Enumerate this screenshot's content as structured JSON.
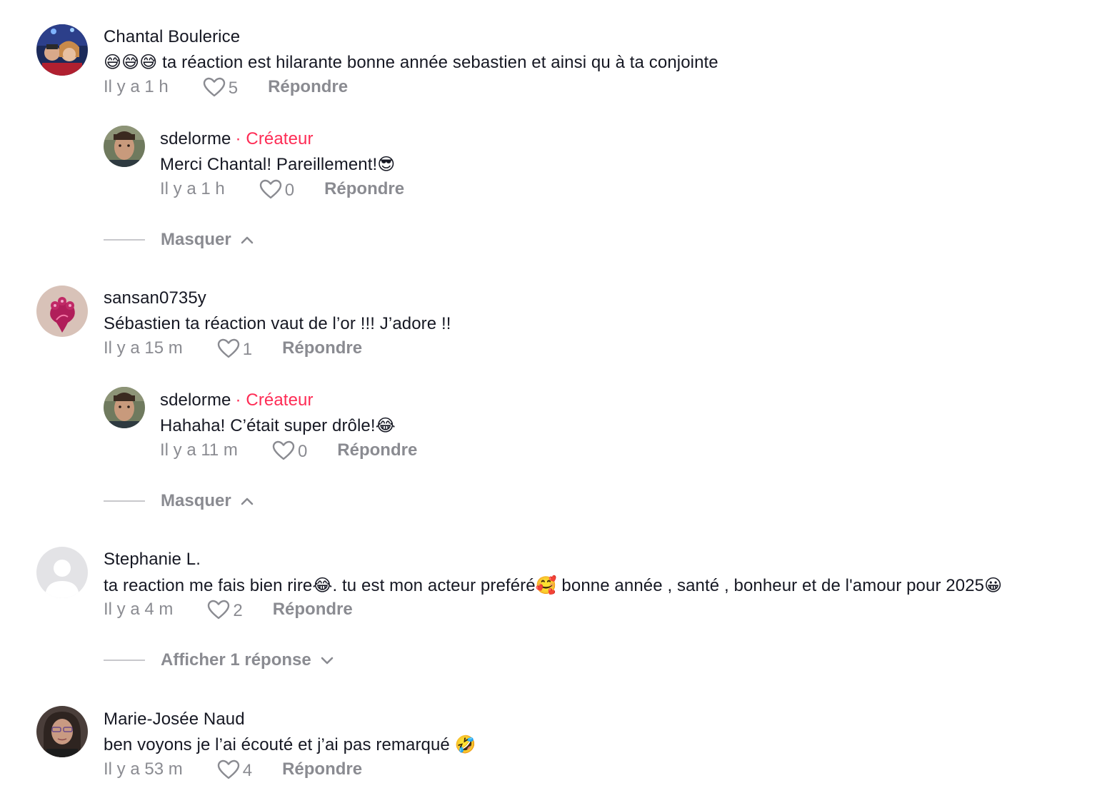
{
  "comments": [
    {
      "username": "Chantal Boulerice",
      "text": "😅😅😅 ta réaction est hilarante bonne année sebastien et ainsi qu à ta conjointe",
      "time": "Il y a 1 h",
      "likes": "5",
      "reply_label": "Répondre",
      "reply": {
        "username": "sdelorme",
        "separator": "·",
        "badge": "Créateur",
        "text": "Merci Chantal! Pareillement!😎",
        "time": "Il y a 1 h",
        "likes": "0",
        "reply_label": "Répondre"
      },
      "toggle_label": "Masquer"
    },
    {
      "username": "sansan0735y",
      "text": "Sébastien ta réaction vaut de l’or !!! J’adore !!",
      "time": "Il y a 15 m",
      "likes": "1",
      "reply_label": "Répondre",
      "reply": {
        "username": "sdelorme",
        "separator": "·",
        "badge": "Créateur",
        "text": "Hahaha! C’était super drôle!😂",
        "time": "Il y a 11 m",
        "likes": "0",
        "reply_label": "Répondre"
      },
      "toggle_label": "Masquer"
    },
    {
      "username": "Stephanie L.",
      "text": "ta reaction me fais bien rire😂. tu est mon acteur preféré🥰 bonne année , santé , bonheur et de l'amour pour 2025😀",
      "time": "Il y a 4 m",
      "likes": "2",
      "reply_label": "Répondre",
      "toggle_label": "Afficher 1 réponse"
    },
    {
      "username": "Marie-Josée Naud",
      "text": "ben voyons je l’ai écouté et j’ai pas remarqué 🤣",
      "time": "Il y a 53 m",
      "likes": "4",
      "reply_label": "Répondre"
    }
  ],
  "colors": {
    "text": "#161823",
    "muted": "#8a8b91",
    "creator": "#fe2c55",
    "divider": "#c8c8cc"
  },
  "icons": {
    "like": "heart-outline-icon",
    "collapse": "chevron-up-icon",
    "expand": "chevron-down-icon",
    "default_avatar": "default-user-avatar-icon"
  }
}
